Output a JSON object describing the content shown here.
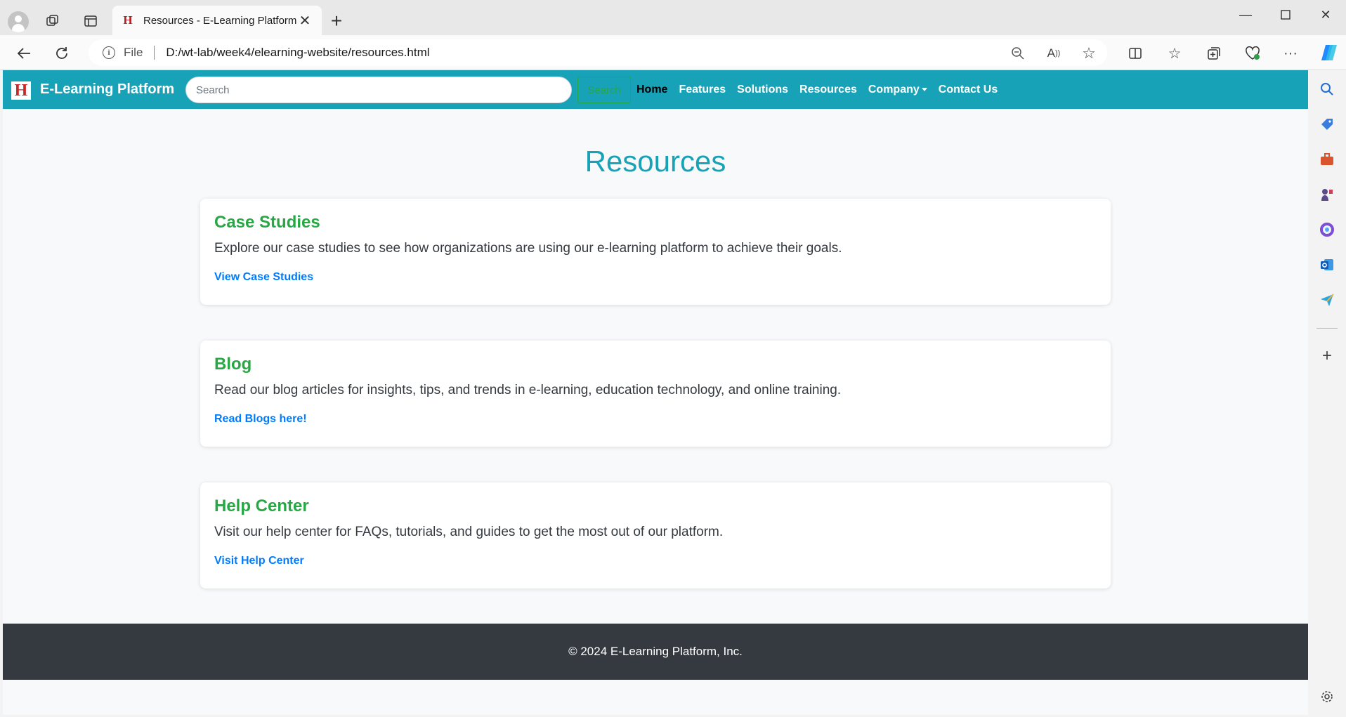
{
  "browser": {
    "tab_title": "Resources - E-Learning Platform",
    "tab_favicon": "H",
    "url_scheme": "File",
    "url": "D:/wt-lab/week4/elearning-website/resources.html",
    "icons": {
      "profile": "profile-icon",
      "workspaces": "workspaces-icon",
      "vertical_tabs": "vertical-tabs-icon",
      "close_tab": "close-icon",
      "new_tab": "plus-icon",
      "back": "back-arrow-icon",
      "refresh": "refresh-icon",
      "info": "info-icon",
      "zoom": "zoom-out-icon",
      "read_aloud": "read-aloud-icon",
      "favorite": "star-icon",
      "split_screen": "split-screen-icon",
      "favorites": "favorites-icon",
      "collections": "collections-icon",
      "browser_essentials": "heart-pulse-icon",
      "more": "more-icon",
      "copilot": "copilot-icon"
    },
    "sidebar_icons": [
      "search-icon",
      "shopping-tag-icon",
      "tools-icon",
      "games-icon",
      "office-icon",
      "outlook-icon",
      "send-icon",
      "add-icon",
      "settings-icon"
    ]
  },
  "site": {
    "brand": "E-Learning Platform",
    "brand_logo": "H",
    "search_placeholder": "Search",
    "search_button": "Search",
    "nav": {
      "home": "Home",
      "features": "Features",
      "solutions": "Solutions",
      "resources": "Resources",
      "company": "Company",
      "contact": "Contact Us"
    },
    "page_title": "Resources",
    "cards": [
      {
        "title": "Case Studies",
        "text": "Explore our case studies to see how organizations are using our e-learning platform to achieve their goals.",
        "link": "View Case Studies"
      },
      {
        "title": "Blog",
        "text": "Read our blog articles for insights, tips, and trends in e-learning, education technology, and online training.",
        "link": "Read Blogs here!"
      },
      {
        "title": "Help Center",
        "text": "Visit our help center for FAQs, tutorials, and guides to get the most out of our platform.",
        "link": "Visit Help Center"
      }
    ],
    "footer": "© 2024 E-Learning Platform, Inc."
  },
  "colors": {
    "navbar": "#17a2b8",
    "title": "#17a2b8",
    "card_title": "#28a745",
    "link": "#007bff",
    "footer": "#343a40"
  }
}
